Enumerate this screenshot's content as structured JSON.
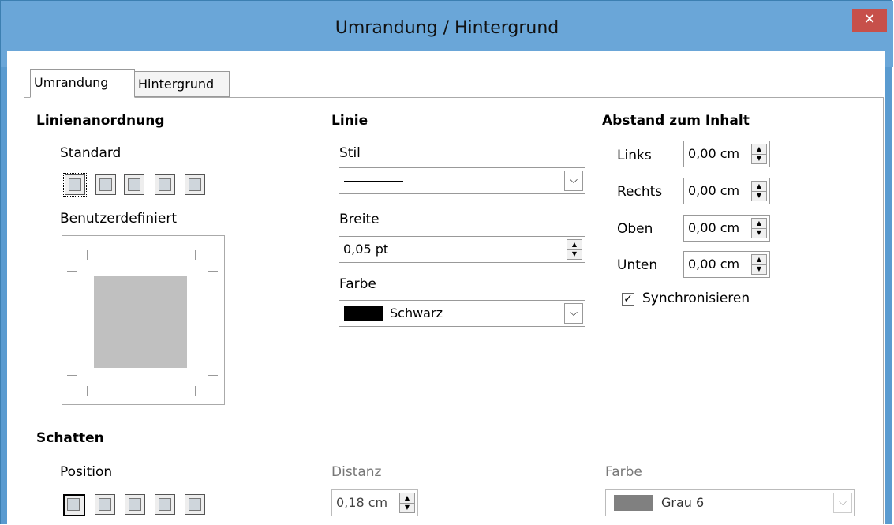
{
  "window": {
    "title": "Umrandung / Hintergrund",
    "close_label": "✕"
  },
  "tabs": [
    {
      "label": "Umrandung",
      "active": true
    },
    {
      "label": "Hintergrund",
      "active": false
    }
  ],
  "line_arrangement": {
    "heading": "Linienanordnung",
    "default_label": "Standard",
    "user_defined_label": "Benutzerdefiniert"
  },
  "line": {
    "heading": "Linie",
    "style_label": "Stil",
    "width_label": "Breite",
    "width_value": "0,05 pt",
    "color_label": "Farbe",
    "color_value": "Schwarz",
    "color_hex": "#000000"
  },
  "spacing": {
    "heading": "Abstand zum Inhalt",
    "fields": [
      {
        "label": "Links",
        "value": "0,00 cm"
      },
      {
        "label": "Rechts",
        "value": "0,00 cm"
      },
      {
        "label": "Oben",
        "value": "0,00 cm"
      },
      {
        "label": "Unten",
        "value": "0,00 cm"
      }
    ],
    "sync_label": "Synchronisieren",
    "sync_checked": true
  },
  "shadow": {
    "heading": "Schatten",
    "position_label": "Position",
    "distance_label": "Distanz",
    "distance_value": "0,18 cm",
    "color_label": "Farbe",
    "color_value": "Grau 6",
    "color_hex": "#808080"
  },
  "icons": {
    "close": "close-icon",
    "dropdown": "chevron-down-icon",
    "spin_up": "spin-up-icon",
    "spin_down": "spin-down-icon",
    "check": "checkmark-icon"
  }
}
